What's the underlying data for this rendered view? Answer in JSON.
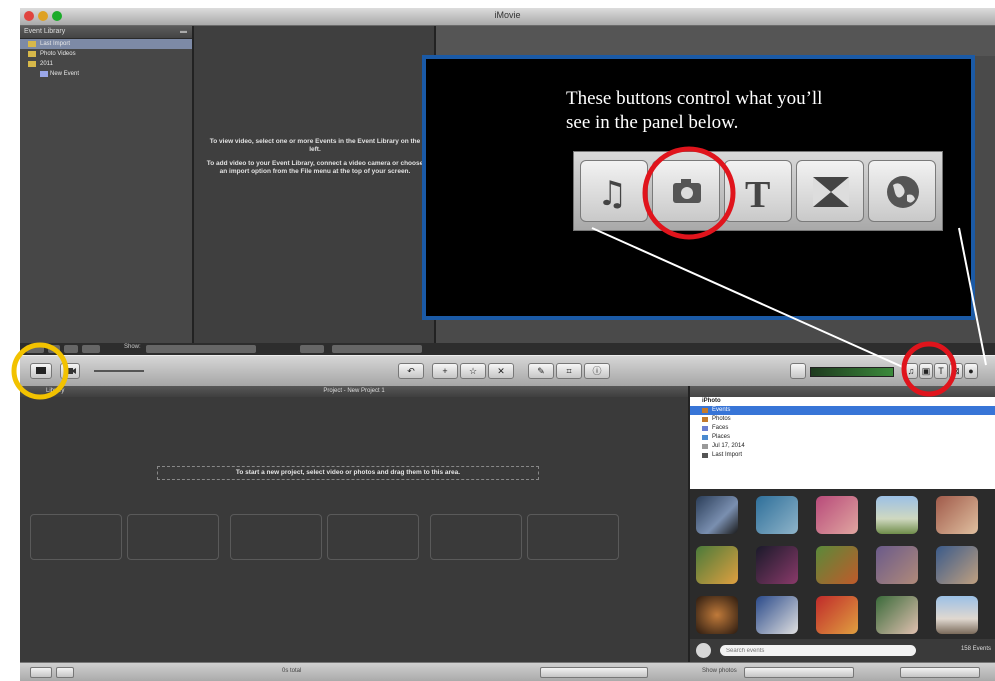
{
  "window": {
    "title": "iMovie"
  },
  "event_library": {
    "header": "Event Library",
    "items": [
      "Last Import",
      "Photo Videos",
      "2011",
      "New Event"
    ]
  },
  "viewer": {
    "message_1": "To view video, select one or more Events in the Event Library on the left.",
    "message_2": "To add video to your Event Library, connect a video camera or choose an import option from the File menu at the top of your screen."
  },
  "annotation": {
    "line_1": "These buttons control what you’ll",
    "line_2": "see in the panel below.",
    "buttons": [
      "music-icon",
      "camera-icon",
      "title-icon",
      "transition-icon",
      "globe-icon"
    ]
  },
  "event_bar": {
    "show_label": "Show:"
  },
  "project": {
    "library_label": "Library",
    "title": "Project - New Project 1",
    "placeholder": "To start a new project, select video or photos and drag them to this area."
  },
  "photos_panel": {
    "items": [
      "iPhoto",
      "Events",
      "Photos",
      "Faces",
      "Places",
      "Jul 17, 2014",
      "Last Import"
    ],
    "selected": "Events",
    "search_placeholder": "Search events",
    "event_count": "158 Events"
  },
  "status_bar": {
    "center_text": "0s total",
    "show_photos": "Show photos"
  },
  "colors": {
    "highlight_red": "#e0141c",
    "highlight_yellow": "#f2c200",
    "preview_border": "#1b5aa6"
  }
}
